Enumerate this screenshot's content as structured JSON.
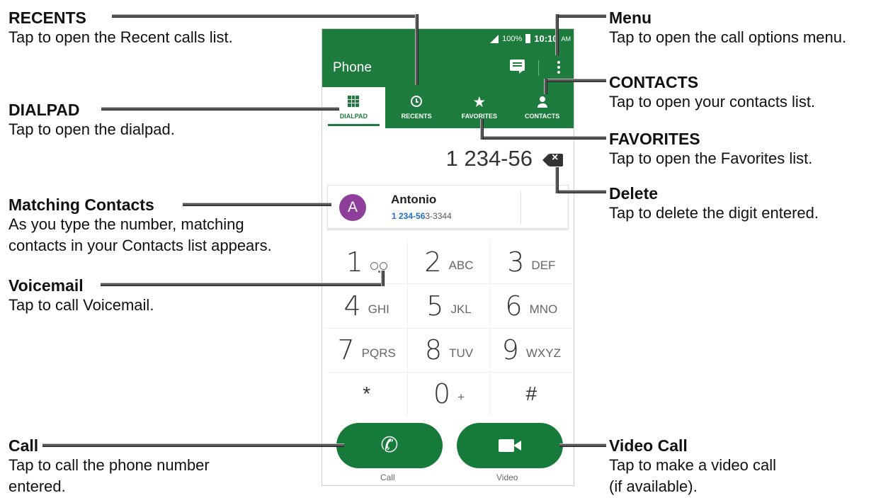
{
  "callouts": {
    "recents": {
      "title": "RECENTS",
      "desc": [
        "Tap to open the Recent calls list."
      ]
    },
    "dialpad": {
      "title": "DIALPAD",
      "desc": [
        "Tap to open the dialpad."
      ]
    },
    "matching": {
      "title": "Matching Contacts",
      "desc": [
        "As you type the number, matching",
        "contacts in your Contacts list appears."
      ]
    },
    "voicemail": {
      "title": "Voicemail",
      "desc": [
        "Tap to call Voicemail."
      ]
    },
    "call": {
      "title": "Call",
      "desc": [
        "Tap to call the phone number",
        "entered."
      ]
    },
    "menu": {
      "title": "Menu",
      "desc": [
        "Tap to open the call options menu."
      ]
    },
    "contacts": {
      "title": "CONTACTS",
      "desc": [
        "Tap to open your contacts list."
      ]
    },
    "favorites": {
      "title": "FAVORITES",
      "desc": [
        "Tap to open the Favorites list."
      ]
    },
    "delete": {
      "title": "Delete",
      "desc": [
        "Tap to delete the digit entered."
      ]
    },
    "video": {
      "title": "Video Call",
      "desc": [
        "Tap to make a video call",
        "(if available)."
      ]
    }
  },
  "phone": {
    "status": {
      "battery": "100%",
      "time": "10:10",
      "ampm": "AM"
    },
    "app_title": "Phone",
    "tabs": [
      {
        "label": "DIALPAD",
        "icon": "dialpad-icon",
        "active": true
      },
      {
        "label": "RECENTS",
        "icon": "recents-icon",
        "active": false
      },
      {
        "label": "FAVORITES",
        "icon": "star-icon",
        "active": false
      },
      {
        "label": "CONTACTS",
        "icon": "person-icon",
        "active": false
      }
    ],
    "dialed_number": "1 234-56",
    "contact": {
      "initial": "A",
      "name": "Antonio",
      "number_match": "1 234-56",
      "number_rest": "3-3344",
      "avatar_color": "#8e3f9b"
    },
    "keys": [
      {
        "digit": "1",
        "letters": ""
      },
      {
        "digit": "2",
        "letters": "ABC"
      },
      {
        "digit": "3",
        "letters": "DEF"
      },
      {
        "digit": "4",
        "letters": "GHI"
      },
      {
        "digit": "5",
        "letters": "JKL"
      },
      {
        "digit": "6",
        "letters": "MNO"
      },
      {
        "digit": "7",
        "letters": "PQRS"
      },
      {
        "digit": "8",
        "letters": "TUV"
      },
      {
        "digit": "9",
        "letters": "WXYZ"
      },
      {
        "digit": "*",
        "letters": ""
      },
      {
        "digit": "0",
        "letters": "+"
      },
      {
        "digit": "#",
        "letters": ""
      }
    ],
    "call_label": "Call",
    "video_label": "Video",
    "accent_color": "#1e7b3e"
  }
}
